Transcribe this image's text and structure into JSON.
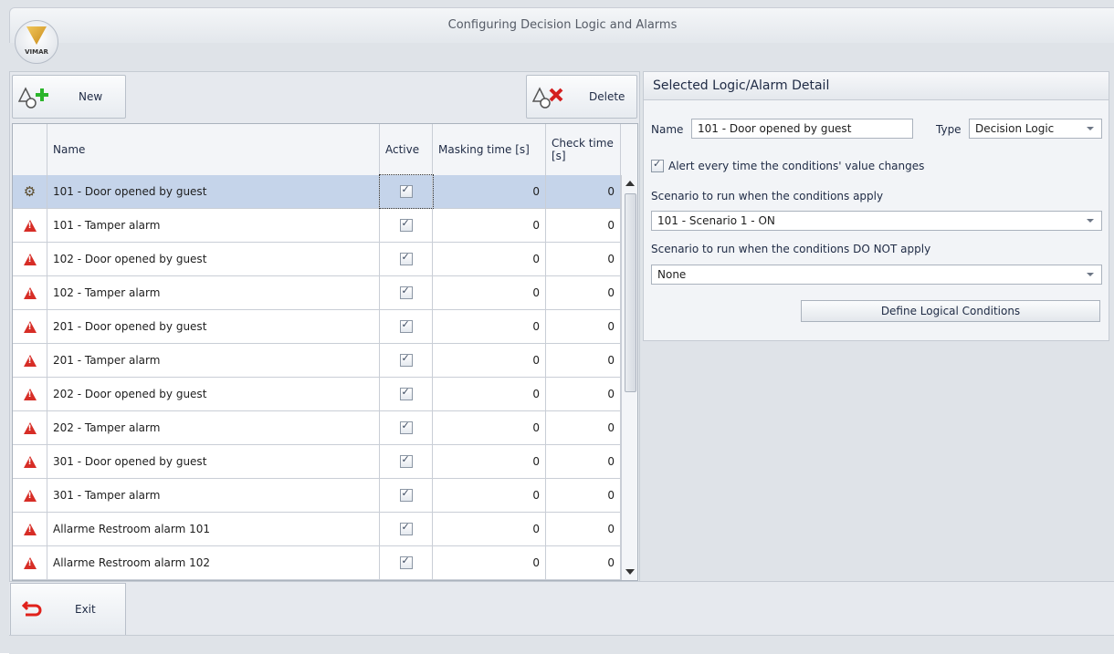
{
  "window": {
    "title": "Configuring Decision Logic and Alarms",
    "logo_text": "VIMAR"
  },
  "toolbar": {
    "new_label": "New",
    "delete_label": "Delete"
  },
  "grid": {
    "columns": [
      "Name",
      "Active",
      "Masking time [s]",
      "Check time [s]"
    ],
    "rows": [
      {
        "name": "101 - Door opened by guest",
        "masking": "0",
        "check": "0",
        "icon": "logic-icon"
      },
      {
        "name": "101 - Tamper alarm",
        "masking": "0",
        "check": "0",
        "icon": "alarm-icon"
      },
      {
        "name": "102 - Door opened by guest",
        "masking": "0",
        "check": "0",
        "icon": "alarm-icon"
      },
      {
        "name": "102 - Tamper alarm",
        "masking": "0",
        "check": "0",
        "icon": "alarm-icon"
      },
      {
        "name": "201 - Door opened by guest",
        "masking": "0",
        "check": "0",
        "icon": "alarm-icon"
      },
      {
        "name": "201 - Tamper alarm",
        "masking": "0",
        "check": "0",
        "icon": "alarm-icon"
      },
      {
        "name": "202 - Door opened by guest",
        "masking": "0",
        "check": "0",
        "icon": "alarm-icon"
      },
      {
        "name": "202 - Tamper alarm",
        "masking": "0",
        "check": "0",
        "icon": "alarm-icon"
      },
      {
        "name": "301 - Door opened by guest",
        "masking": "0",
        "check": "0",
        "icon": "alarm-icon"
      },
      {
        "name": "301 - Tamper alarm",
        "masking": "0",
        "check": "0",
        "icon": "alarm-icon"
      },
      {
        "name": "Allarme Restroom alarm 101",
        "masking": "0",
        "check": "0",
        "icon": "alarm-icon"
      },
      {
        "name": "Allarme Restroom alarm 102",
        "masking": "0",
        "check": "0",
        "icon": "alarm-icon"
      }
    ]
  },
  "detail": {
    "title": "Selected Logic/Alarm Detail",
    "name_label": "Name",
    "name_value": "101 - Door opened by guest",
    "type_label": "Type",
    "type_value": "Decision Logic",
    "alert_label": "Alert every time the conditions' value changes",
    "scenario_apply_label": "Scenario to run when the conditions apply",
    "scenario_apply_value": "101 - Scenario 1 - ON",
    "scenario_not_apply_label": "Scenario to run when the conditions DO NOT apply",
    "scenario_not_apply_value": "None",
    "define_button": "Define Logical Conditions"
  },
  "footer": {
    "exit_label": "Exit"
  },
  "colors": {
    "alarm": "#d72d26",
    "selection": "#c5d4ea",
    "new_plus": "#2bb52b",
    "delete_x": "#d41f1f"
  }
}
